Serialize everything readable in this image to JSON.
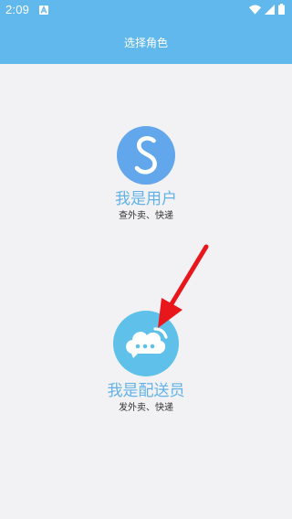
{
  "status_bar": {
    "time": "2:09",
    "icons": [
      "notification-a-icon",
      "wifi-icon",
      "signal-icon",
      "battery-icon"
    ]
  },
  "header": {
    "title": "选择角色"
  },
  "roles": [
    {
      "title": "我是用户",
      "description": "查外卖、快递",
      "icon": "s-logo-icon"
    },
    {
      "title": "我是配送员",
      "description": "发外卖、快递",
      "icon": "chat-bubble-icon"
    }
  ],
  "colors": {
    "header_bg": "#61b8ec",
    "page_bg": "#f2f2f4",
    "role_title": "#62b2e6",
    "user_icon_bg": "#62a6eb",
    "courier_icon_bg": "#5fc0ea",
    "annotation_arrow": "#e8171c"
  }
}
